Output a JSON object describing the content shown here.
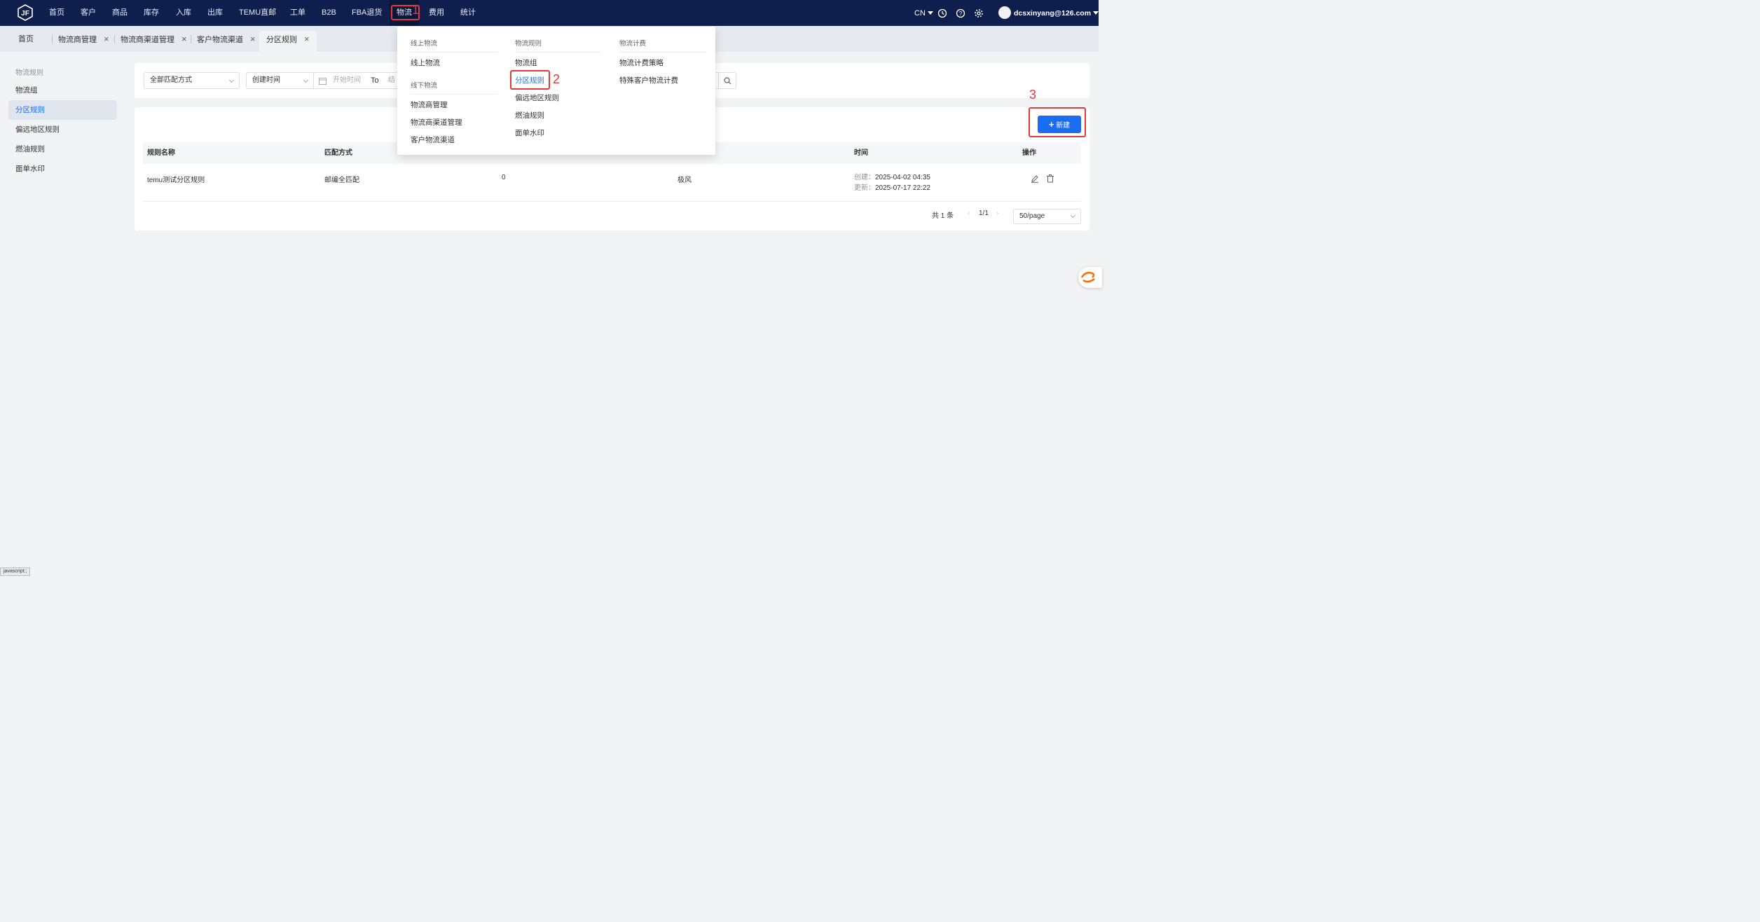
{
  "nav": {
    "items": [
      "首页",
      "客户",
      "商品",
      "库存",
      "入库",
      "出库",
      "TEMU直邮",
      "工单",
      "B2B",
      "FBA退货",
      "物流",
      "费用",
      "统计"
    ],
    "active": "物流",
    "lang": "CN",
    "user": "dcsxinyang@126.com"
  },
  "tabs": [
    {
      "label": "首页"
    },
    {
      "label": "物流商管理"
    },
    {
      "label": "物流商渠道管理"
    },
    {
      "label": "客户物流渠道"
    },
    {
      "label": "分区规则"
    }
  ],
  "close_glyph": "×",
  "sidebar": {
    "title": "物流规则",
    "items": [
      "物流组",
      "分区规则",
      "偏远地区规则",
      "燃油规则",
      "面单水印"
    ],
    "active": "分区规则"
  },
  "filter": {
    "match_select": "全部匹配方式",
    "time_select": "创建时间",
    "start_placeholder": "开始时间",
    "to": "To",
    "end_placeholder": "结"
  },
  "toolbar": {
    "new_label": "新建"
  },
  "table": {
    "headers": [
      "规则名称",
      "匹配方式",
      "",
      "",
      "时间",
      "操作"
    ],
    "rows": [
      {
        "name": "temu测试分区规则",
        "match": "邮编全匹配",
        "count": "0",
        "col4": "极风",
        "created_label": "创建：",
        "created": "2025-04-02 04:35",
        "updated_label": "更新：",
        "updated": "2025-07-17 22:22"
      }
    ]
  },
  "pager": {
    "total": "共 1 条",
    "page": "1/1",
    "size": "50/page"
  },
  "menu": {
    "col1": {
      "online_head": "线上物流",
      "online_items": [
        "线上物流"
      ],
      "offline_head": "线下物流",
      "offline_items": [
        "物流商管理",
        "物流商渠道管理",
        "客户物流渠道"
      ]
    },
    "col2": {
      "head": "物流规则",
      "items": [
        "物流组",
        "分区规则",
        "偏远地区规则",
        "燃油规则",
        "面单水印"
      ]
    },
    "col3": {
      "head": "物流计费",
      "items": [
        "物流计费策略",
        "特殊客户物流计费"
      ]
    }
  },
  "steps": [
    "1",
    "2",
    "3"
  ],
  "status_bar": "javascript:;",
  "colors": {
    "nav_bg": "#0e1f4d",
    "primary": "#1a6cf0",
    "highlight": "#e5383b"
  },
  "icons": [
    "app-logo-icon",
    "caret-down-icon",
    "clock-icon",
    "help-icon",
    "gear-icon",
    "avatar",
    "calendar-icon",
    "search-icon",
    "plus-icon",
    "edit-icon",
    "delete-icon",
    "info-icon",
    "alibaba-1688-icon"
  ]
}
